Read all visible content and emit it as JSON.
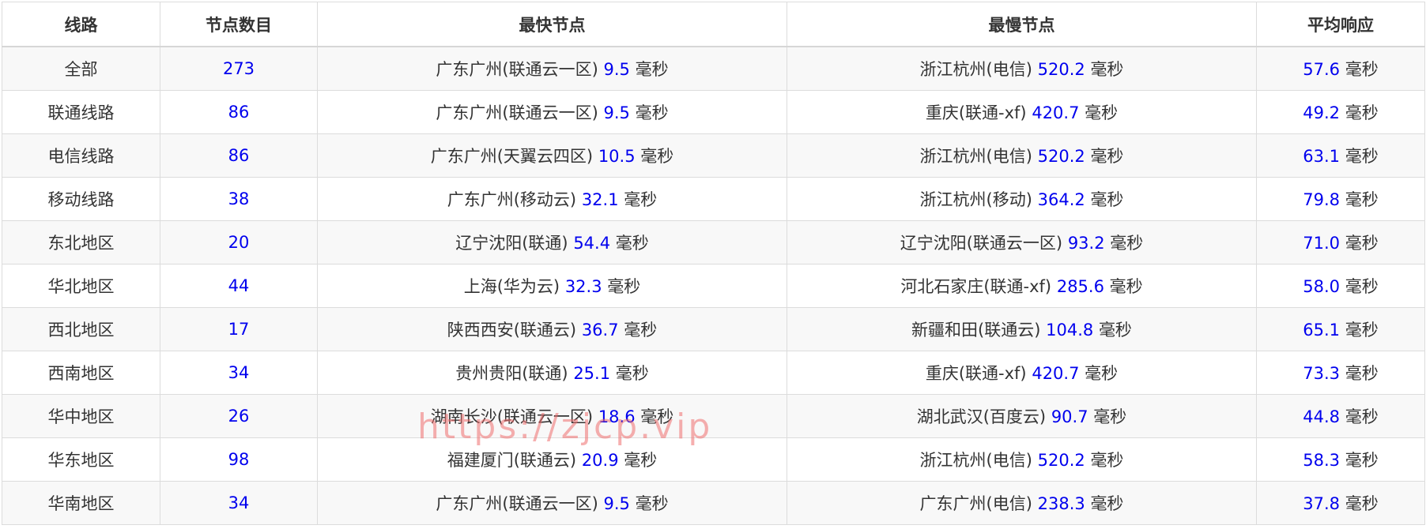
{
  "table": {
    "headers": [
      "线路",
      "节点数目",
      "最快节点",
      "最慢节点",
      "平均响应"
    ],
    "unit": "毫秒",
    "rows": [
      {
        "line": "全部",
        "count": "273",
        "fast_name": "广东广州(联通云一区)",
        "fast_ms": "9.5",
        "slow_name": "浙江杭州(电信)",
        "slow_ms": "520.2",
        "avg_ms": "57.6"
      },
      {
        "line": "联通线路",
        "count": "86",
        "fast_name": "广东广州(联通云一区)",
        "fast_ms": "9.5",
        "slow_name": "重庆(联通-xf)",
        "slow_ms": "420.7",
        "avg_ms": "49.2"
      },
      {
        "line": "电信线路",
        "count": "86",
        "fast_name": "广东广州(天翼云四区)",
        "fast_ms": "10.5",
        "slow_name": "浙江杭州(电信)",
        "slow_ms": "520.2",
        "avg_ms": "63.1"
      },
      {
        "line": "移动线路",
        "count": "38",
        "fast_name": "广东广州(移动云)",
        "fast_ms": "32.1",
        "slow_name": "浙江杭州(移动)",
        "slow_ms": "364.2",
        "avg_ms": "79.8"
      },
      {
        "line": "东北地区",
        "count": "20",
        "fast_name": "辽宁沈阳(联通)",
        "fast_ms": "54.4",
        "slow_name": "辽宁沈阳(联通云一区)",
        "slow_ms": "93.2",
        "avg_ms": "71.0"
      },
      {
        "line": "华北地区",
        "count": "44",
        "fast_name": "上海(华为云)",
        "fast_ms": "32.3",
        "slow_name": "河北石家庄(联通-xf)",
        "slow_ms": "285.6",
        "avg_ms": "58.0"
      },
      {
        "line": "西北地区",
        "count": "17",
        "fast_name": "陕西西安(联通云)",
        "fast_ms": "36.7",
        "slow_name": "新疆和田(联通云)",
        "slow_ms": "104.8",
        "avg_ms": "65.1"
      },
      {
        "line": "西南地区",
        "count": "34",
        "fast_name": "贵州贵阳(联通)",
        "fast_ms": "25.1",
        "slow_name": "重庆(联通-xf)",
        "slow_ms": "420.7",
        "avg_ms": "73.3"
      },
      {
        "line": "华中地区",
        "count": "26",
        "fast_name": "湖南长沙(联通云一区)",
        "fast_ms": "18.6",
        "slow_name": "湖北武汉(百度云)",
        "slow_ms": "90.7",
        "avg_ms": "44.8"
      },
      {
        "line": "华东地区",
        "count": "98",
        "fast_name": "福建厦门(联通云)",
        "fast_ms": "20.9",
        "slow_name": "浙江杭州(电信)",
        "slow_ms": "520.2",
        "avg_ms": "58.3"
      },
      {
        "line": "华南地区",
        "count": "34",
        "fast_name": "广东广州(联通云一区)",
        "fast_ms": "9.5",
        "slow_name": "广东广州(电信)",
        "slow_ms": "238.3",
        "avg_ms": "37.8"
      }
    ]
  },
  "watermark": "https://zjcp.vip",
  "colors": {
    "value_blue": "#0000ee",
    "text": "#333333",
    "stripe": "#f8f8f8",
    "border": "#dcdcdc",
    "watermark": "#ee6e6e"
  }
}
